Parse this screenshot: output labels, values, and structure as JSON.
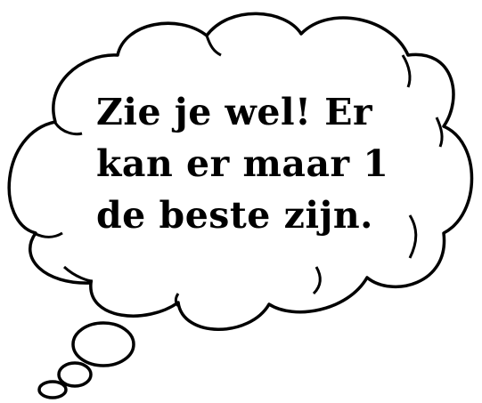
{
  "thought_bubble": {
    "lines": [
      "Zie je wel! Er",
      "kan er maar 1",
      "de beste zijn."
    ],
    "stroke_color": "#000000",
    "fill_color": "#ffffff",
    "text_color": "#000000"
  }
}
